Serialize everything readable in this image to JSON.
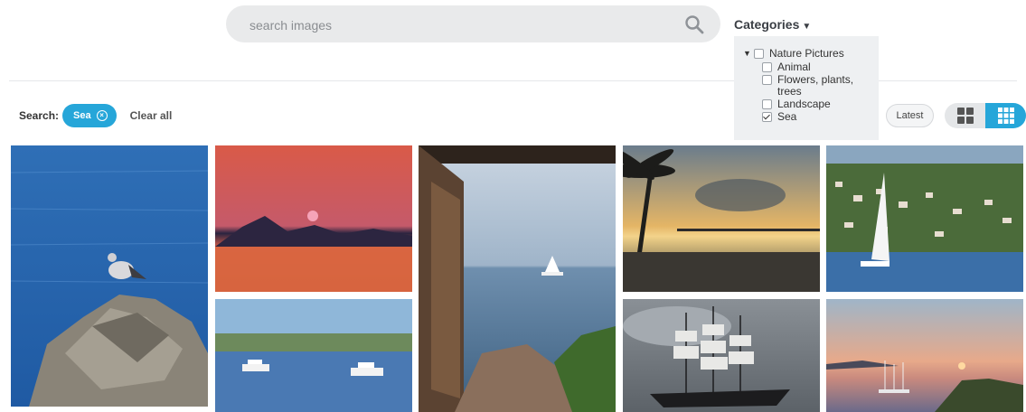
{
  "search": {
    "placeholder": "search images"
  },
  "categories": {
    "label": "Categories",
    "tree": {
      "parent": {
        "label": "Nature Pictures",
        "checked": false,
        "expanded": true
      },
      "children": [
        {
          "label": "Animal",
          "checked": false
        },
        {
          "label": "Flowers, plants, trees",
          "checked": false
        },
        {
          "label": "Landscape",
          "checked": false
        },
        {
          "label": "Sea",
          "checked": true
        }
      ]
    }
  },
  "filters": {
    "label": "Search:",
    "active_chip": "Sea",
    "clear_label": "Clear all"
  },
  "view": {
    "sort_label": "Latest",
    "modes": [
      {
        "name": "large-grid",
        "active": false
      },
      {
        "name": "small-grid",
        "active": true
      }
    ]
  },
  "gallery": {
    "photos": [
      {
        "subject": "seagull on rock by the sea"
      },
      {
        "subject": "red sunset over mountains and sea"
      },
      {
        "subject": "ferries on a waterway by a city"
      },
      {
        "subject": "sea view through an open wooden door with sailboat"
      },
      {
        "subject": "palm tree and pier at sunset"
      },
      {
        "subject": "old tall ship under cloudy sky"
      },
      {
        "subject": "sailboat in a bay with hillside houses"
      },
      {
        "subject": "sailboats in a bay at sunset"
      }
    ]
  },
  "colors": {
    "accent": "#26a6d9",
    "search_bg": "#e9eaeb",
    "panel_bg": "#eef0f2"
  }
}
